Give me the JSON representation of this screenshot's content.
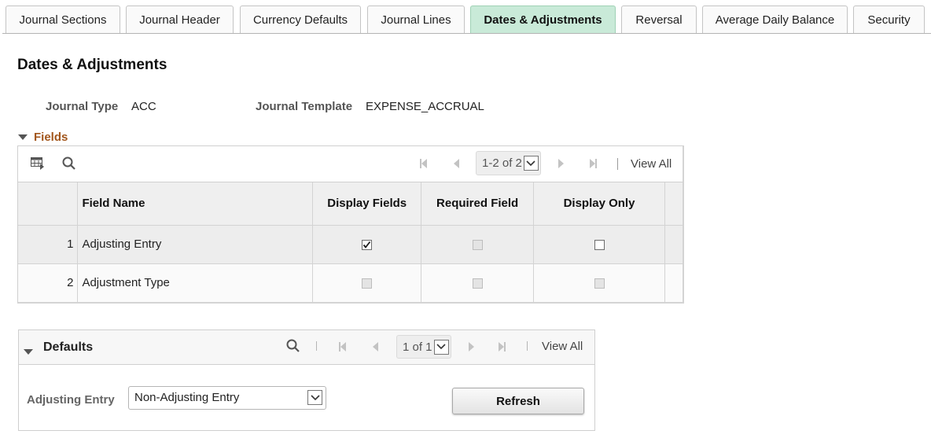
{
  "tabs": [
    {
      "label": "Journal Sections",
      "active": false
    },
    {
      "label": "Journal Header",
      "active": false
    },
    {
      "label": "Currency Defaults",
      "active": false
    },
    {
      "label": "Journal Lines",
      "active": false
    },
    {
      "label": "Dates & Adjustments",
      "active": true
    },
    {
      "label": "Reversal",
      "active": false
    },
    {
      "label": "Average Daily Balance",
      "active": false
    },
    {
      "label": "Security",
      "active": false
    }
  ],
  "page": {
    "title": "Dates & Adjustments",
    "journal_type_label": "Journal Type",
    "journal_type_value": "ACC",
    "journal_template_label": "Journal Template",
    "journal_template_value": "EXPENSE_ACCRUAL"
  },
  "fields_section": {
    "title": "Fields",
    "icons": {
      "personalize": "grid-personalize-icon",
      "find": "search-icon"
    },
    "pager_text": "1-2 of 2",
    "view_all": "View All",
    "columns": [
      "",
      "Field Name",
      "Display Fields",
      "Required Field",
      "Display Only",
      ""
    ],
    "rows": [
      {
        "num": "1",
        "field_name": "Adjusting Entry",
        "display_fields": {
          "checked": true,
          "enabled": true
        },
        "required_field": {
          "checked": false,
          "enabled": false
        },
        "display_only": {
          "checked": false,
          "enabled": true
        }
      },
      {
        "num": "2",
        "field_name": "Adjustment Type",
        "display_fields": {
          "checked": false,
          "enabled": false
        },
        "required_field": {
          "checked": false,
          "enabled": false
        },
        "display_only": {
          "checked": false,
          "enabled": false
        }
      }
    ]
  },
  "defaults_section": {
    "title": "Defaults",
    "pager_text": "1 of 1",
    "view_all": "View All",
    "adjusting_entry_label": "Adjusting Entry",
    "adjusting_entry_value": "Non-Adjusting Entry",
    "refresh_label": "Refresh"
  },
  "colors": {
    "active_tab": "#c9ead8",
    "section_title": "#a2561c"
  }
}
